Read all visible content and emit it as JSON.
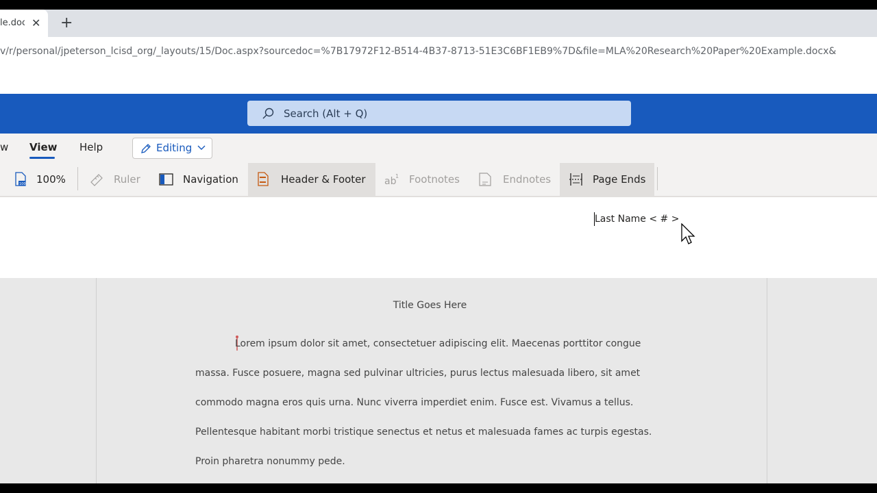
{
  "browser": {
    "tab_title": "le.doc",
    "tab_close": "✕",
    "new_tab": "+",
    "url": "v/r/personal/jpeterson_lcisd_org/_layouts/15/Doc.aspx?sourcedoc=%7B17972F12-B514-4B37-8713-51E3C6BF1EB9%7D&file=MLA%20Research%20Paper%20Example.docx&"
  },
  "appbar": {
    "search_placeholder": "Search (Alt + Q)",
    "accent": "#185abd"
  },
  "ribbon_tabs": {
    "prev_partial": "w",
    "view": "View",
    "help": "Help",
    "editing": "Editing"
  },
  "ribbon_commands": {
    "zoom": "100%",
    "ruler": "Ruler",
    "navigation": "Navigation",
    "header_footer": "Header & Footer",
    "footnotes": "Footnotes",
    "endnotes": "Endnotes",
    "page_ends": "Page Ends"
  },
  "header": {
    "text": "Last Name < # >"
  },
  "document": {
    "title": "Title Goes Here",
    "lines": [
      "Lorem ipsum dolor sit amet, consectetuer adipiscing elit. Maecenas porttitor congue",
      "massa. Fusce posuere, magna sed pulvinar ultricies, purus lectus malesuada libero, sit amet",
      "commodo magna eros quis urna. Nunc viverra imperdiet enim. Fusce est. Vivamus a tellus.",
      "Pellentesque habitant morbi tristique senectus et netus et malesuada fames ac turpis egestas.",
      "Proin pharetra nonummy pede."
    ]
  }
}
